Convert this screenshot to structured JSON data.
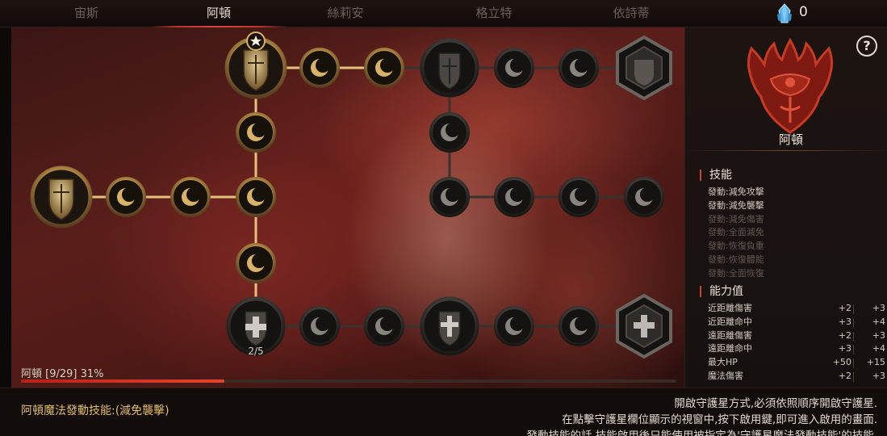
{
  "tabs": [
    {
      "label": "宙斯",
      "active": false
    },
    {
      "label": "阿頓",
      "active": true
    },
    {
      "label": "絲莉安",
      "active": false
    },
    {
      "label": "格立特",
      "active": false
    },
    {
      "label": "依詩蒂",
      "active": false
    }
  ],
  "currency": {
    "icon": "blue-crystal-icon",
    "count": "0"
  },
  "tree": {
    "locked_node_counter": "2/5",
    "progress": {
      "label": "阿頓 [9/29] 31%",
      "fraction": 0.31
    }
  },
  "sidebar": {
    "help_label": "?",
    "character_name": "阿頓",
    "emblem_icon": "red-winged-crest-icon",
    "skills_title": "技能",
    "skills": [
      {
        "label": "發動:減免攻擊",
        "unlocked": true
      },
      {
        "label": "發動:減免襲擊",
        "unlocked": true
      },
      {
        "label": "發動:減免傷害",
        "unlocked": false
      },
      {
        "label": "發動:全面減免",
        "unlocked": false
      },
      {
        "label": "發動:恢復負重",
        "unlocked": false
      },
      {
        "label": "發動:恢復體能",
        "unlocked": false
      },
      {
        "label": "發動:全面恢復",
        "unlocked": false
      }
    ],
    "stats_title": "能力值",
    "stats": [
      {
        "name": "近距離傷害",
        "current": "+2",
        "next": "+3"
      },
      {
        "name": "近距離命中",
        "current": "+3",
        "next": "+4"
      },
      {
        "name": "遠距離傷害",
        "current": "+2",
        "next": "+3"
      },
      {
        "name": "遠距離命中",
        "current": "+3",
        "next": "+4"
      },
      {
        "name": "最大HP",
        "current": "+50",
        "next": "+15"
      },
      {
        "name": "魔法傷害",
        "current": "+2",
        "next": "+3"
      }
    ]
  },
  "footer": {
    "active_skill": "阿頓魔法發動技能:(減免襲擊)",
    "notice_lines": [
      "開啟守護星方式,必須依照順序開啟守護星.",
      "在點擊守護星欄位顯示的視窗中,按下啟用鍵,即可進入啟用的畫面.",
      "發動技能的話,技能啟用後只能使用被指定為'守護星魔法發動技能'的技能."
    ]
  },
  "colors": {
    "accent_red": "#c5452e",
    "gold": "#d8b266",
    "progress_fill": "#d23a2a",
    "skill_text": "#e2bd6a"
  }
}
